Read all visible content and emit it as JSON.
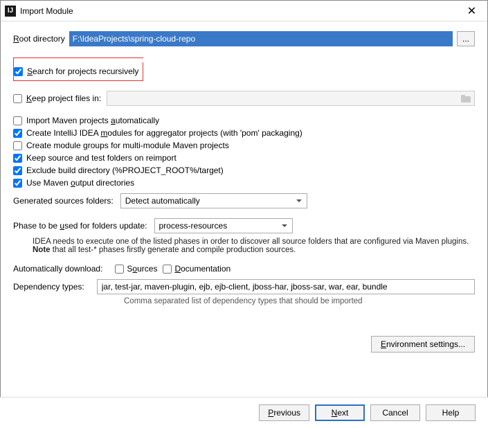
{
  "window": {
    "title": "Import Module"
  },
  "root": {
    "label_pre": "",
    "label_u": "R",
    "label_post": "oot directory",
    "value": "F:\\IdeaProjects\\spring-cloud-repo",
    "browse": "..."
  },
  "search_recursive": {
    "pre": "",
    "u": "S",
    "post": "earch for projects recursively",
    "checked": true
  },
  "keep_files": {
    "pre": "",
    "u": "K",
    "post": "eep project files in:",
    "checked": false,
    "value": ""
  },
  "options": {
    "import_auto": {
      "pre": "Import Maven projects ",
      "u": "a",
      "post": "utomatically",
      "checked": false
    },
    "create_modules": {
      "pre": "Create IntelliJ IDEA ",
      "u": "m",
      "post": "odules for aggregator projects (with 'pom' packaging)",
      "checked": true
    },
    "module_groups": {
      "pre": "Create module ",
      "u": "g",
      "post": "roups for multi-module Maven projects",
      "checked": false
    },
    "keep_source": {
      "text": "Keep source and test folders on reimport",
      "checked": true
    },
    "exclude_build": {
      "text": "Exclude build directory (%PROJECT_ROOT%/target)",
      "checked": true
    },
    "use_output": {
      "pre": "Use Maven ",
      "u": "o",
      "post": "utput directories",
      "checked": true
    }
  },
  "generated": {
    "label": "Generated sources folders:",
    "value": "Detect automatically"
  },
  "phase": {
    "label_pre": "Phase to be ",
    "label_u": "u",
    "label_post": "sed for folders update:",
    "value": "process-resources",
    "help_line1": "IDEA needs to execute one of the listed phases in order to discover all source folders that are configured via Maven plugins.",
    "help_bold": "Note",
    "help_line2": " that all test-* phases firstly generate and compile production sources."
  },
  "autodl": {
    "label": "Automatically download:",
    "sources": {
      "pre": "S",
      "u": "o",
      "post": "urces",
      "checked": false
    },
    "docs": {
      "pre": "",
      "u": "D",
      "post": "ocumentation",
      "checked": false
    }
  },
  "deps": {
    "label": "Dependency types:",
    "value": "jar, test-jar, maven-plugin, ejb, ejb-client, jboss-har, jboss-sar, war, ear, bundle",
    "help": "Comma separated list of dependency types that should be imported"
  },
  "env_button": {
    "pre": "",
    "u": "E",
    "post": "nvironment settings..."
  },
  "footer": {
    "previous": {
      "pre": "",
      "u": "P",
      "post": "revious"
    },
    "next": {
      "pre": "",
      "u": "N",
      "post": "ext"
    },
    "cancel": "Cancel",
    "help": "Help"
  }
}
